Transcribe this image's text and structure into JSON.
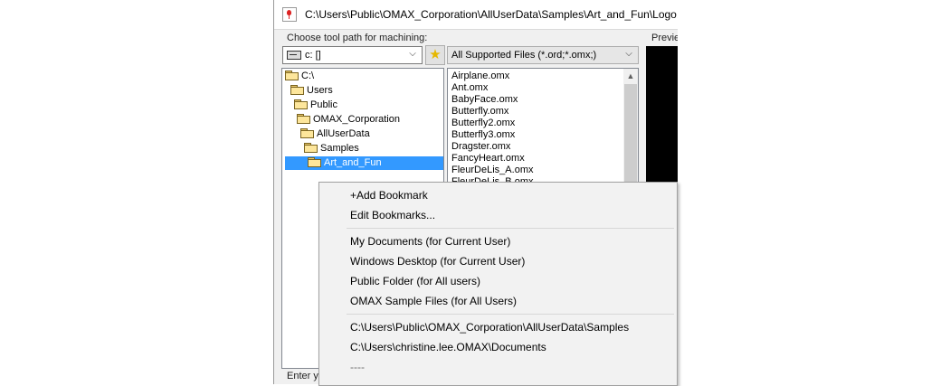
{
  "window": {
    "title": "C:\\Users\\Public\\OMAX_Corporation\\AllUserData\\Samples\\Art_and_Fun\\Logo.",
    "group_label": "Choose tool path for machining:",
    "preview_label": "Previe",
    "bottom_label": "Enter yo"
  },
  "drive_select": {
    "value": "c: []"
  },
  "filter_select": {
    "value": "All Supported Files (*.ord;*.omx;)"
  },
  "icons": {
    "app": "omax-app-icon",
    "drive": "hard-drive-icon",
    "bookmark": "star-icon",
    "folder": "folder-icon",
    "accent_star_color": "#e6b800",
    "selection_color": "#3399ff"
  },
  "directory_tree": [
    {
      "label": "C:\\"
    },
    {
      "label": "Users"
    },
    {
      "label": "Public"
    },
    {
      "label": "OMAX_Corporation"
    },
    {
      "label": "AllUserData"
    },
    {
      "label": "Samples"
    },
    {
      "label": "Art_and_Fun",
      "selected": true
    }
  ],
  "file_list": [
    "Airplane.omx",
    "Ant.omx",
    "BabyFace.omx",
    "Butterfly.omx",
    "Butterfly2.omx",
    "Butterfly3.omx",
    "Dragster.omx",
    "FancyHeart.omx",
    "FleurDeLis_A.omx",
    "FleurDeLis_B.omx"
  ],
  "context_menu": {
    "group_1": [
      "+Add Bookmark",
      "Edit Bookmarks..."
    ],
    "group_2": [
      "My Documents (for Current User)",
      "Windows Desktop (for Current User)",
      "Public Folder (for All users)",
      "OMAX Sample Files (for All Users)"
    ],
    "group_3": [
      "C:\\Users\\Public\\OMAX_Corporation\\AllUserData\\Samples",
      "C:\\Users\\christine.lee.OMAX\\Documents"
    ],
    "placeholder_item": "----"
  }
}
